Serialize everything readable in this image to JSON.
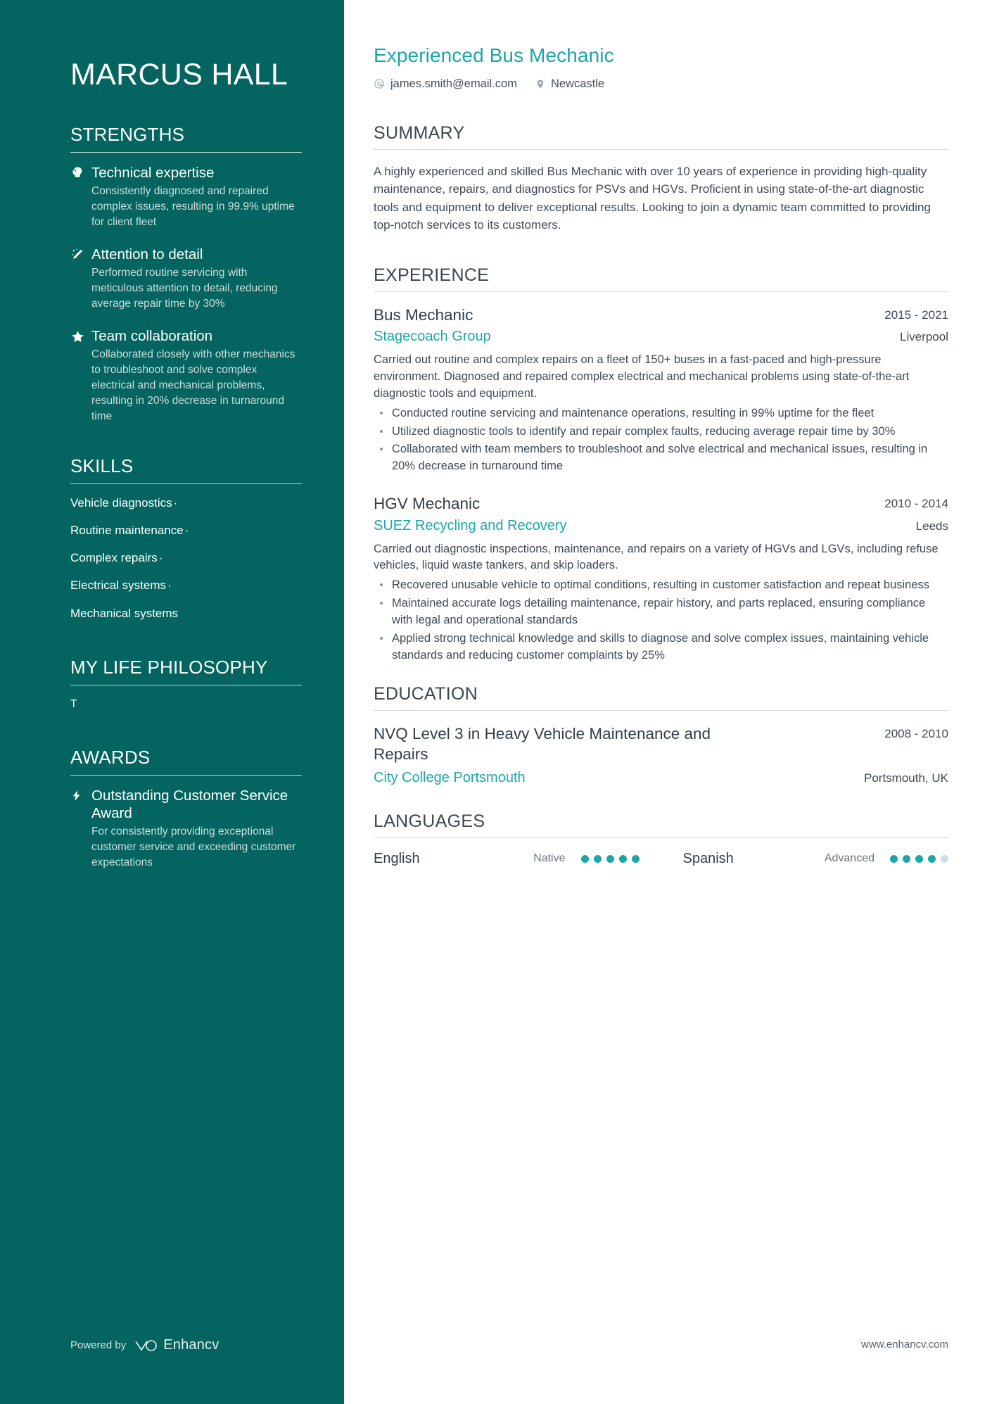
{
  "sidebar": {
    "name": "MARCUS HALL",
    "strengths": {
      "title": "STRENGTHS",
      "items": [
        {
          "icon": "head-idea-icon",
          "title": "Technical expertise",
          "desc": "Consistently diagnosed and repaired complex issues, resulting in 99.9% uptime for client fleet"
        },
        {
          "icon": "magic-wand-icon",
          "title": "Attention to detail",
          "desc": "Performed routine servicing with meticulous attention to detail, reducing average repair time by 30%"
        },
        {
          "icon": "star-icon",
          "title": "Team collaboration",
          "desc": "Collaborated closely with other mechanics to troubleshoot and solve complex electrical and mechanical problems, resulting in 20% decrease in turnaround time"
        }
      ]
    },
    "skills": {
      "title": "SKILLS",
      "items": [
        {
          "label": "Vehicle diagnostics",
          "sep": "·"
        },
        {
          "label": "Routine maintenance",
          "sep": "·"
        },
        {
          "label": "Complex repairs",
          "sep": "·"
        },
        {
          "label": "Electrical systems",
          "sep": "·"
        },
        {
          "label": "Mechanical systems",
          "sep": ""
        }
      ]
    },
    "philosophy": {
      "title": "MY LIFE PHILOSOPHY",
      "text": "T"
    },
    "awards": {
      "title": "AWARDS",
      "items": [
        {
          "icon": "lightning-bolt-icon",
          "title": "Outstanding Customer Service Award",
          "desc": "For consistently providing exceptional customer service and exceeding customer expectations"
        }
      ]
    },
    "footer": {
      "powered_by": "Powered by",
      "brand": "Enhancv"
    }
  },
  "main": {
    "job_title": "Experienced Bus Mechanic",
    "contacts": [
      {
        "icon": "at-icon",
        "value": "james.smith@email.com"
      },
      {
        "icon": "map-pin-icon",
        "value": "Newcastle"
      }
    ],
    "summary": {
      "title": "SUMMARY",
      "text": "A highly experienced and skilled Bus Mechanic with over 10 years of experience in providing high-quality maintenance, repairs, and diagnostics for PSVs and HGVs. Proficient in using state-of-the-art diagnostic tools and equipment to deliver exceptional results. Looking to join a dynamic team committed to providing top-notch services to its customers."
    },
    "experience": {
      "title": "EXPERIENCE",
      "entries": [
        {
          "role": "Bus Mechanic",
          "date": "2015 - 2021",
          "org": "Stagecoach Group",
          "location": "Liverpool",
          "desc": "Carried out routine and complex repairs on a fleet of 150+ buses in a fast-paced and high-pressure environment. Diagnosed and repaired complex electrical and mechanical problems using state-of-the-art diagnostic tools and equipment.",
          "bullets": [
            "Conducted routine servicing and maintenance operations, resulting in 99% uptime for the fleet",
            "Utilized diagnostic tools to identify and repair complex faults, reducing average repair time by 30%",
            "Collaborated with team members to troubleshoot and solve electrical and mechanical issues, resulting in 20% decrease in turnaround time"
          ]
        },
        {
          "role": "HGV Mechanic",
          "date": "2010 - 2014",
          "org": "SUEZ Recycling and Recovery",
          "location": "Leeds",
          "desc": "Carried out diagnostic inspections, maintenance, and repairs on a variety of HGVs and LGVs, including refuse vehicles, liquid waste tankers, and skip loaders.",
          "bullets": [
            "Recovered unusable vehicle to optimal conditions, resulting in customer satisfaction and repeat business",
            "Maintained accurate logs detailing maintenance, repair history, and parts replaced, ensuring compliance with legal and operational standards",
            "Applied strong technical knowledge and skills to diagnose and solve complex issues, maintaining vehicle standards and reducing customer complaints by 25%"
          ]
        }
      ]
    },
    "education": {
      "title": "EDUCATION",
      "entries": [
        {
          "degree": "NVQ Level 3 in Heavy Vehicle Maintenance and Repairs",
          "date": "2008 - 2010",
          "school": "City College Portsmouth",
          "location": "Portsmouth, UK"
        }
      ]
    },
    "languages": {
      "title": "LANGUAGES",
      "items": [
        {
          "name": "English",
          "level": "Native",
          "filled": 5,
          "total": 5
        },
        {
          "name": "Spanish",
          "level": "Advanced",
          "filled": 4,
          "total": 5
        }
      ]
    },
    "footer_url": "www.enhancv.com"
  },
  "colors": {
    "sidebar_bg": "#036460",
    "accent": "#1aa7a7",
    "text": "#3c464f"
  }
}
